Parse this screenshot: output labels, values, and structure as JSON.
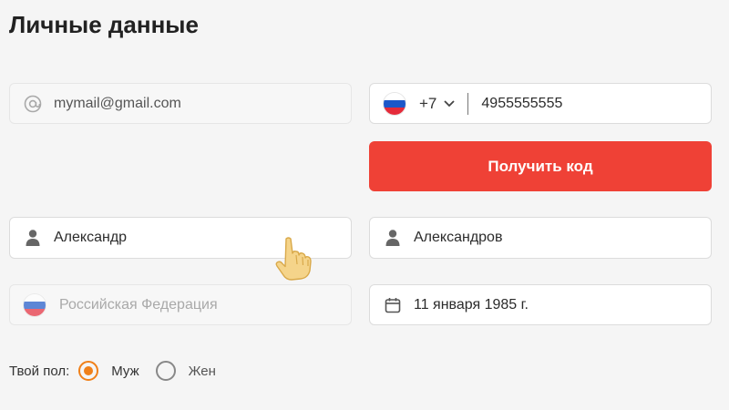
{
  "page": {
    "title": "Личные данные"
  },
  "email": {
    "value": "mymail@gmail.com",
    "icon": "at-icon"
  },
  "phone": {
    "country_code": "+7",
    "number": "4955555555",
    "flag": "russia-flag-icon"
  },
  "get_code_button": {
    "label": "Получить код",
    "color": "#ef4136"
  },
  "first_name": {
    "value": "Александр",
    "icon": "user-icon"
  },
  "last_name": {
    "value": "Александров",
    "icon": "user-icon"
  },
  "country": {
    "placeholder": "Российская Федерация",
    "flag": "russia-flag-icon"
  },
  "birth_date": {
    "value": "11 января 1985 г.",
    "icon": "calendar-icon"
  },
  "gender": {
    "label": "Твой пол:",
    "options": [
      {
        "label": "Муж",
        "selected": true
      },
      {
        "label": "Жен",
        "selected": false
      }
    ],
    "accent": "#f08019"
  }
}
